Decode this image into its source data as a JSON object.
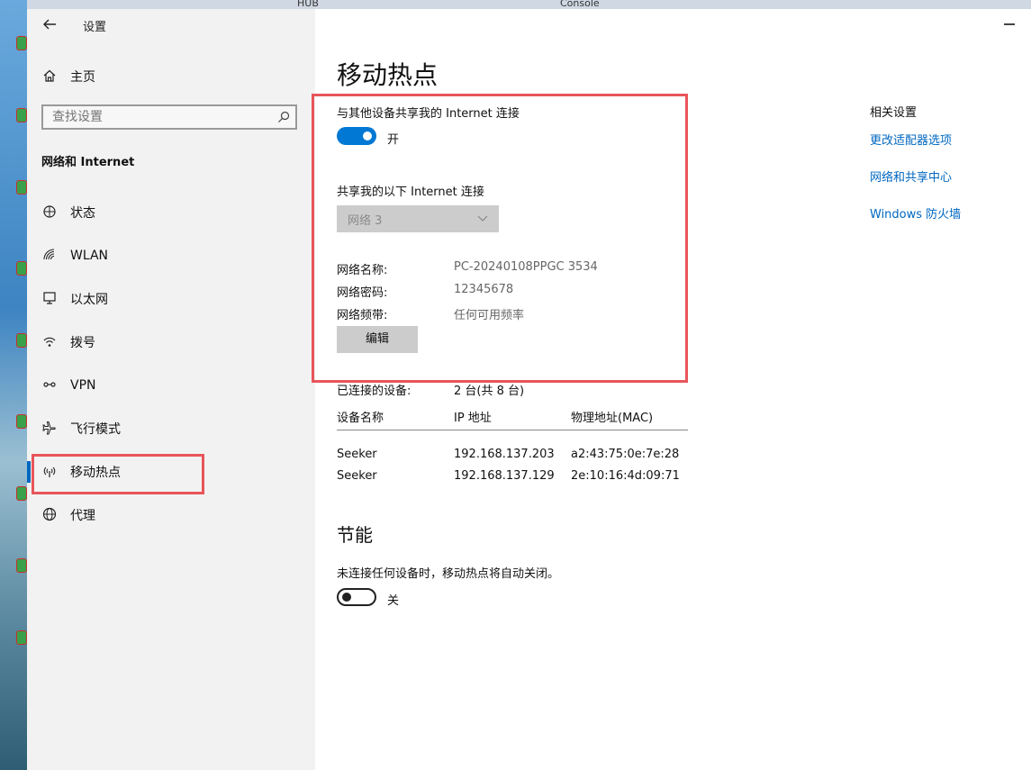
{
  "desktop": {
    "top_labels": [
      "HUB",
      "Console"
    ]
  },
  "window": {
    "title": "设置",
    "close_icon": "close-icon"
  },
  "sidebar": {
    "home_label": "主页",
    "search_placeholder": "查找设置",
    "section_title": "网络和 Internet",
    "items": [
      {
        "label": "状态",
        "icon": "status-icon"
      },
      {
        "label": "WLAN",
        "icon": "wifi-icon"
      },
      {
        "label": "以太网",
        "icon": "ethernet-icon"
      },
      {
        "label": "拨号",
        "icon": "dialup-icon"
      },
      {
        "label": "VPN",
        "icon": "vpn-icon"
      },
      {
        "label": "飞行模式",
        "icon": "airplane-icon"
      },
      {
        "label": "移动热点",
        "icon": "hotspot-icon",
        "active": true
      },
      {
        "label": "代理",
        "icon": "globe-icon"
      }
    ]
  },
  "main": {
    "title": "移动热点",
    "share_label": "与其他设备共享我的 Internet 连接",
    "share_toggle": {
      "state": "on",
      "text": "开"
    },
    "share_from_label": "共享我的以下 Internet 连接",
    "share_from_value": "网络 3",
    "network_name_label": "网络名称:",
    "network_name_value": "PC-20240108PPGC 3534",
    "network_password_label": "网络密码:",
    "network_password_value": "12345678",
    "network_band_label": "网络频带:",
    "network_band_value": "任何可用频率",
    "edit_button": "编辑",
    "connected_label": "已连接的设备:",
    "connected_value": "2 台(共 8 台)",
    "table": {
      "headers": [
        "设备名称",
        "IP 地址",
        "物理地址(MAC)"
      ],
      "rows": [
        [
          "Seeker",
          "192.168.137.203",
          "a2:43:75:0e:7e:28"
        ],
        [
          "Seeker",
          "192.168.137.129",
          "2e:10:16:4d:09:71"
        ]
      ]
    },
    "power_title": "节能",
    "power_desc": "未连接任何设备时，移动热点将自动关闭。",
    "power_toggle": {
      "state": "off",
      "text": "关"
    }
  },
  "related": {
    "title": "相关设置",
    "links": [
      "更改适配器选项",
      "网络和共享中心",
      "Windows 防火墙"
    ]
  },
  "colors": {
    "accent": "#0078d4",
    "link": "#0067c0",
    "highlight_box": "#e8555a"
  }
}
